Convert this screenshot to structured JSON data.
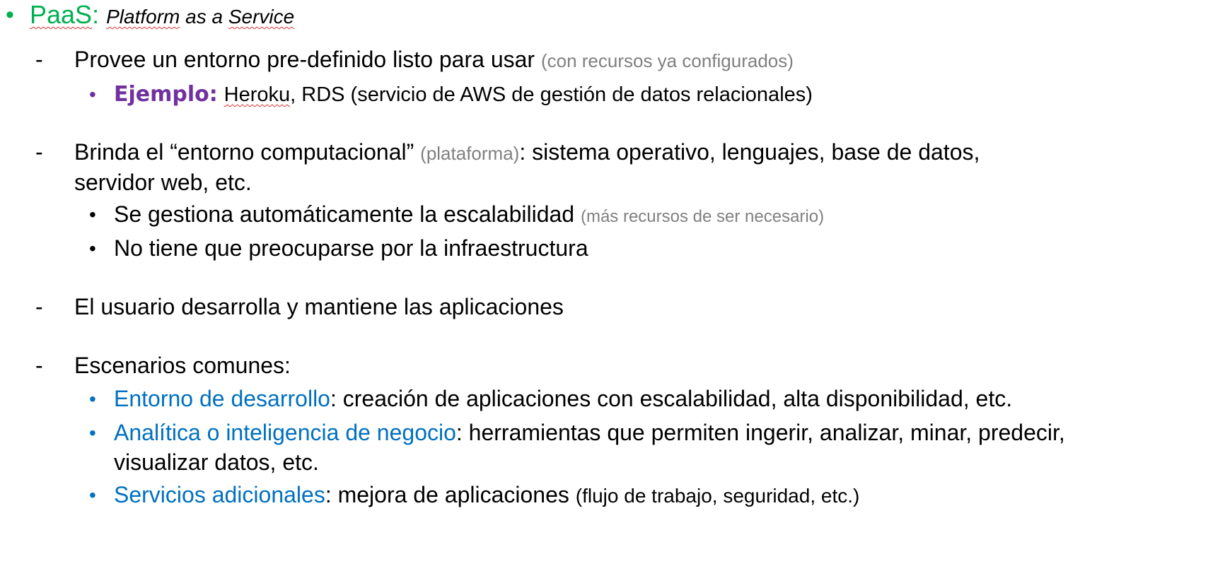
{
  "title": {
    "term": "PaaS",
    "colon": ":",
    "subtitle_word1": "Platform",
    "subtitle_rest": " as a ",
    "subtitle_word2": "Service"
  },
  "items": [
    {
      "marker": "-",
      "text": "Provee un entorno pre-definido listo para usar ",
      "note": "(con recursos ya configurados)",
      "sub": [
        {
          "label": "Ejemplo:",
          "name_underlined": "Heroku",
          "text": ", RDS (servicio de AWS de gestión de datos relacionales)"
        }
      ]
    },
    {
      "marker": "-",
      "text_a": "Brinda el “entorno computacional” ",
      "note": "(plataforma)",
      "text_b": ": sistema operativo, lenguajes, base de datos,",
      "text_line2": "servidor web, etc.",
      "sub": [
        {
          "text": "Se gestiona automáticamente la escalabilidad ",
          "note": "(más recursos de ser necesario)"
        },
        {
          "text": "No tiene que preocuparse por la infraestructura"
        }
      ]
    },
    {
      "marker": "-",
      "text": "El usuario desarrolla y mantiene las aplicaciones"
    },
    {
      "marker": "-",
      "text": "Escenarios comunes:",
      "sub": [
        {
          "label": "Entorno de desarrollo",
          "text": ": creación de aplicaciones con escalabilidad, alta disponibilidad, etc."
        },
        {
          "label": "Analítica o inteligencia de negocio",
          "text": ": herramientas que permiten ingerir, analizar, minar, predecir,",
          "text_line2": "visualizar datos, etc."
        },
        {
          "label": "Servicios adicionales",
          "text": ": mejora de aplicaciones ",
          "note": "(flujo de trabajo, seguridad, etc.)"
        }
      ]
    }
  ],
  "bullet_glyph": "•",
  "colors": {
    "green": "#00b050",
    "purple": "#7030a0",
    "blue": "#0070c0",
    "gray": "#808080"
  }
}
